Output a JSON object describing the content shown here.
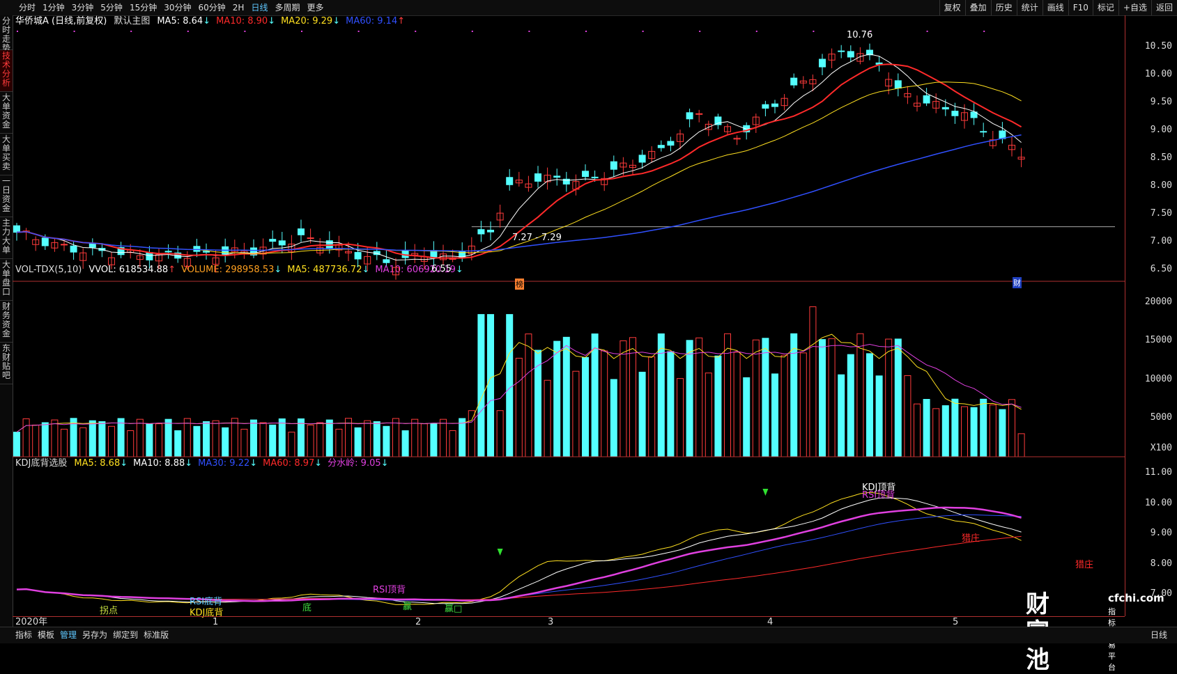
{
  "topbar": {
    "left_items": [
      "分时",
      "1分钟",
      "3分钟",
      "5分钟",
      "15分钟",
      "30分钟",
      "60分钟",
      "2H",
      "日线",
      "多周期",
      "更多"
    ],
    "active": "日线",
    "right_items": [
      "复权",
      "叠加",
      "历史",
      "统计",
      "画线",
      "F10",
      "标记",
      "+自选",
      "返回"
    ]
  },
  "sidebar": [
    {
      "label": "分时走势",
      "active": false
    },
    {
      "label": "技术分析",
      "active": true
    },
    {
      "label": "大单资金",
      "active": false
    },
    {
      "label": "大单买卖",
      "active": false
    },
    {
      "label": "一日资金",
      "active": false
    },
    {
      "label": "主力大单",
      "active": false
    },
    {
      "label": "大单盘口",
      "active": false
    },
    {
      "label": "财务资金",
      "active": false
    },
    {
      "label": "东财贴吧",
      "active": false
    }
  ],
  "main_panel": {
    "title": "华侨城A (日线,前复权)",
    "indicator": "默认主图",
    "ma": [
      {
        "label": "MA5: 8.64",
        "arrow": "↓",
        "color": "#ffffff"
      },
      {
        "label": "MA10: 8.90",
        "arrow": "↓",
        "color": "#ff2a2a"
      },
      {
        "label": "MA20: 9.29",
        "arrow": "↓",
        "color": "#ffe020"
      },
      {
        "label": "MA60: 9.14",
        "arrow": "↑",
        "color": "#3050ff"
      }
    ],
    "y_ticks": [
      "10.50",
      "10.00",
      "9.50",
      "9.00",
      "8.50",
      "8.00",
      "7.50",
      "7.00",
      "6.50"
    ],
    "y_range": [
      6.3,
      10.85
    ],
    "annotations": {
      "high": "10.76",
      "low": "6.55",
      "mid": "7.27 - 7.29",
      "tag_bang": "榜",
      "tag_cai": "财"
    }
  },
  "volume_panel": {
    "title": "VOL-TDX(5,10)",
    "items": [
      {
        "label": "VVOL: 618534.88",
        "arrow": "↑",
        "color": "#ffffff"
      },
      {
        "label": "VOLUME: 298958.53",
        "arrow": "↓",
        "color": "#ffa020"
      },
      {
        "label": "MA5: 487736.72",
        "arrow": "↓",
        "color": "#ffe020"
      },
      {
        "label": "MA10: 606920.19",
        "arrow": "↓",
        "color": "#e040e0"
      }
    ],
    "y_ticks": [
      "20000",
      "15000",
      "10000",
      "5000"
    ],
    "unit": "X100"
  },
  "kdj_panel": {
    "title": "KDJ底背选股",
    "items": [
      {
        "label": "MA5: 8.68",
        "arrow": "↓",
        "color": "#ffe020"
      },
      {
        "label": "MA10: 8.88",
        "arrow": "↓",
        "color": "#ffffff"
      },
      {
        "label": "MA30: 9.22",
        "arrow": "↓",
        "color": "#3050ff"
      },
      {
        "label": "MA60: 8.97",
        "arrow": "↓",
        "color": "#ff2a2a"
      },
      {
        "label": "分水岭: 9.05",
        "arrow": "↓",
        "color": "#e040e0"
      }
    ],
    "y_ticks": [
      "11.00",
      "10.00",
      "9.00",
      "8.00",
      "7.00"
    ],
    "signals": {
      "kdj_top": "KDJ顶背",
      "rsi_top_1": "RSI顶背",
      "rsi_top_2": "RSI顶背",
      "rsi_bottom": "RSI底背",
      "kdj_bottom": "KDJ底背",
      "turn": "拐点",
      "di": "底",
      "ying1": "赢",
      "ying2": "赢□",
      "lie1": "猎庄",
      "lie2": "猎庄"
    }
  },
  "date_axis": [
    "2020年",
    "1",
    "2",
    "3",
    "4",
    "5"
  ],
  "bottombar": {
    "items": [
      "指标",
      "模板",
      "管理",
      "另存为",
      "绑定到",
      "标准版"
    ],
    "active": "管理",
    "right": "日线"
  },
  "watermark": {
    "brand": "财富池",
    "site": "cfchi.com",
    "slogan": "指标交易平台"
  },
  "colors": {
    "up": "#ff3b3b",
    "down": "#54ffff",
    "ma5": "#ffffff",
    "ma10": "#ff2a2a",
    "ma20": "#ffe020",
    "ma60": "#3050ff",
    "ma_mag": "#e040e0"
  }
}
